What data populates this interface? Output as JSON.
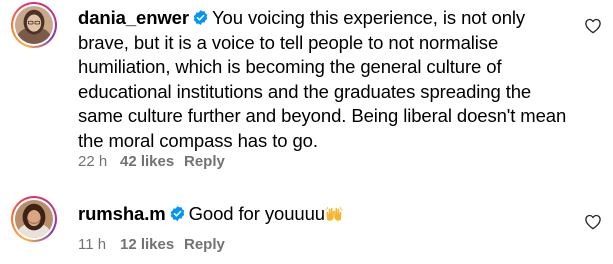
{
  "comments": [
    {
      "username": "dania_enwer",
      "verified": true,
      "text": "You voicing this experience, is not only brave, but it is a voice to tell people to not normalise humiliation, which is becoming the general culture of educational institutions and the graduates spreading the same culture further and beyond. Being liberal doesn't mean the moral compass has to go.",
      "time": "22 h",
      "likes": "42 likes",
      "reply_label": "Reply",
      "icons": [
        "avatar",
        "verified-badge-icon",
        "heart-icon"
      ]
    },
    {
      "username": "rumsha.m",
      "verified": true,
      "text": "Good for youuuu",
      "emoji": "raising-hands-emoji",
      "time": "11 h",
      "likes": "12 likes",
      "reply_label": "Reply",
      "icons": [
        "avatar",
        "verified-badge-icon",
        "heart-icon"
      ]
    }
  ],
  "colors": {
    "verified_badge": "#0095f6",
    "meta_text": "#737373",
    "text": "#000000"
  }
}
